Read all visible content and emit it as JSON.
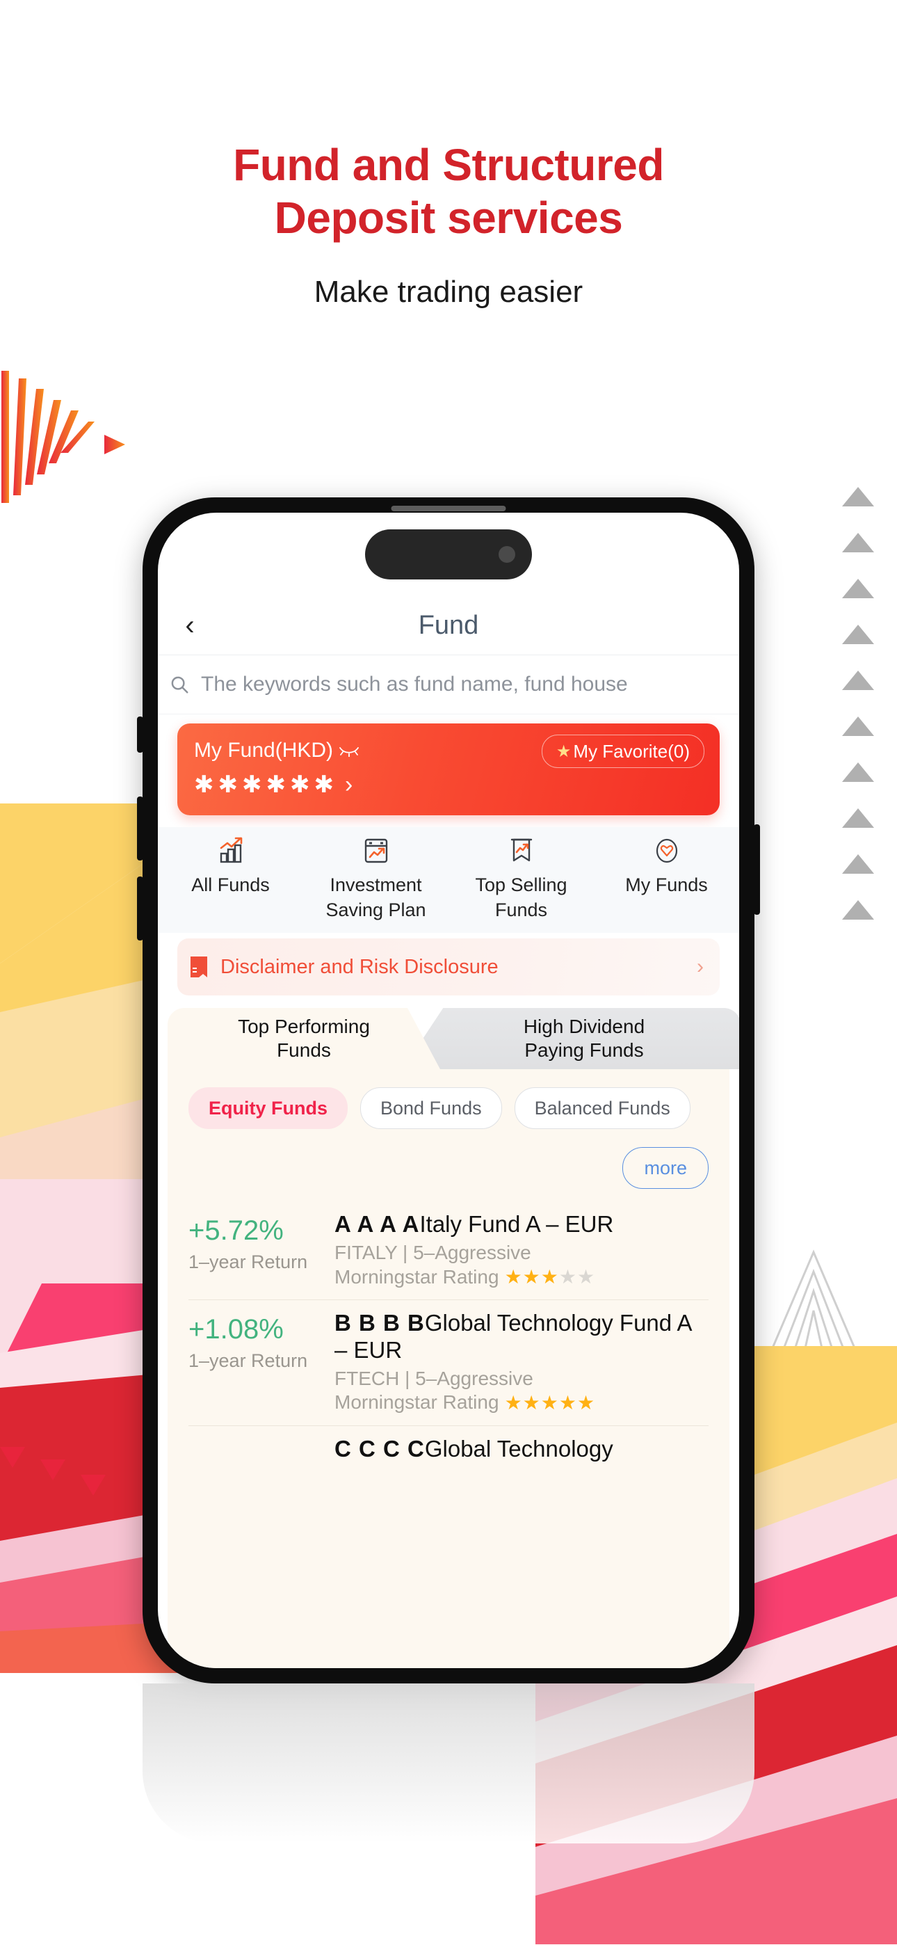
{
  "promo": {
    "headline_line1": "Fund and Structured",
    "headline_line2": "Deposit services",
    "subheadline": "Make trading easier",
    "headline_color": "#d2232a"
  },
  "app": {
    "nav": {
      "back_label": "‹",
      "title": "Fund"
    },
    "search": {
      "placeholder": "The keywords such as fund name, fund house",
      "icon": "search-icon"
    },
    "fund_card": {
      "title": "My Fund(HKD)",
      "eye_icon": "eye-slash-icon",
      "favorite_label": "My Favorite(0)",
      "favorite_star": "★",
      "masked_amount": "✱✱✱✱✱✱",
      "chevron": "›",
      "gradient_from": "#fb6a43",
      "gradient_to": "#f42f25"
    },
    "quick_actions": [
      {
        "label": "All Funds",
        "icon": "bar-chart-trend-icon"
      },
      {
        "label": "Investment\nSaving Plan",
        "icon": "calendar-trend-icon"
      },
      {
        "label": "Top Selling\nFunds",
        "icon": "banner-trend-icon"
      },
      {
        "label": "My Funds",
        "icon": "heart-circle-icon"
      }
    ],
    "disclaimer": {
      "label": "Disclaimer and Risk Disclosure",
      "icon": "document-icon",
      "chevron": "›",
      "color": "#f04e38"
    },
    "tabs": [
      {
        "label": "Top Performing\nFunds",
        "active": true
      },
      {
        "label": "High Dividend\nPaying Funds",
        "active": false
      }
    ],
    "chips": [
      {
        "label": "Equity Funds",
        "active": true
      },
      {
        "label": "Bond Funds",
        "active": false
      },
      {
        "label": "Balanced Funds",
        "active": false
      }
    ],
    "more_label": "more",
    "funds": [
      {
        "return_pct": "+5.72%",
        "return_label": "1–year Return",
        "code_prefix": "A A A A",
        "name": "Italy Fund A – EUR",
        "meta": "FITALY | 5–Aggressive",
        "rating_label": "Morningstar Rating",
        "rating": 3,
        "rating_max": 5
      },
      {
        "return_pct": "+1.08%",
        "return_label": "1–year Return",
        "code_prefix": "B B B B",
        "name": "Global Technology Fund A – EUR",
        "meta": "FTECH | 5–Aggressive",
        "rating_label": "Morningstar Rating",
        "rating": 5,
        "rating_max": 5
      },
      {
        "return_pct": "",
        "return_label": "",
        "code_prefix": "C C C C",
        "name": "Global Technology",
        "meta": "",
        "rating_label": "",
        "rating": 0,
        "rating_max": 5
      }
    ]
  }
}
